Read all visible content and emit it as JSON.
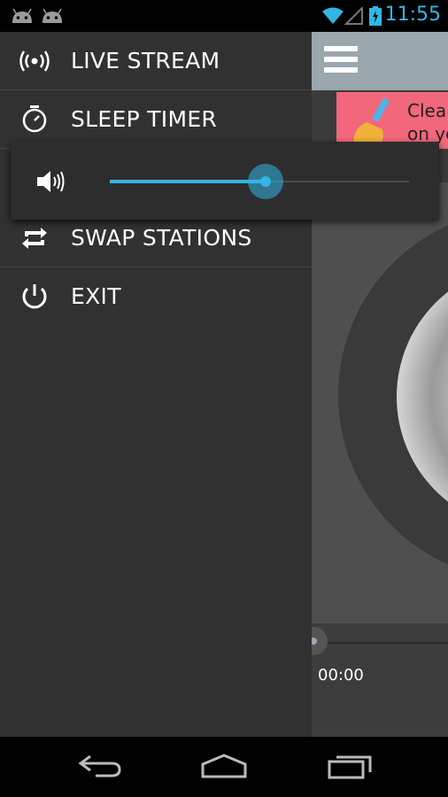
{
  "status_bar": {
    "time": "11:55",
    "accent_color": "#33b5e5",
    "icons": [
      "android-icon",
      "android-icon",
      "wifi-icon",
      "signal-icon",
      "battery-icon"
    ]
  },
  "drawer": {
    "items": [
      {
        "label": "LIVE STREAM",
        "icon": "broadcast-icon"
      },
      {
        "label": "SLEEP TIMER",
        "icon": "stopwatch-icon"
      },
      {
        "label": "SWAP STATIONS",
        "icon": "swap-icon"
      },
      {
        "label": "EXIT",
        "icon": "power-icon"
      }
    ]
  },
  "volume": {
    "icon": "speaker-icon",
    "level": 0.52,
    "accent_color": "#33b5e5"
  },
  "main": {
    "menu_icon": "hamburger-icon",
    "ad_text_line1": "Clea",
    "ad_text_line2": "on yo",
    "elapsed_time": "00:00"
  },
  "nav_bar": {
    "buttons": [
      "back-icon",
      "home-icon",
      "recents-icon"
    ]
  }
}
